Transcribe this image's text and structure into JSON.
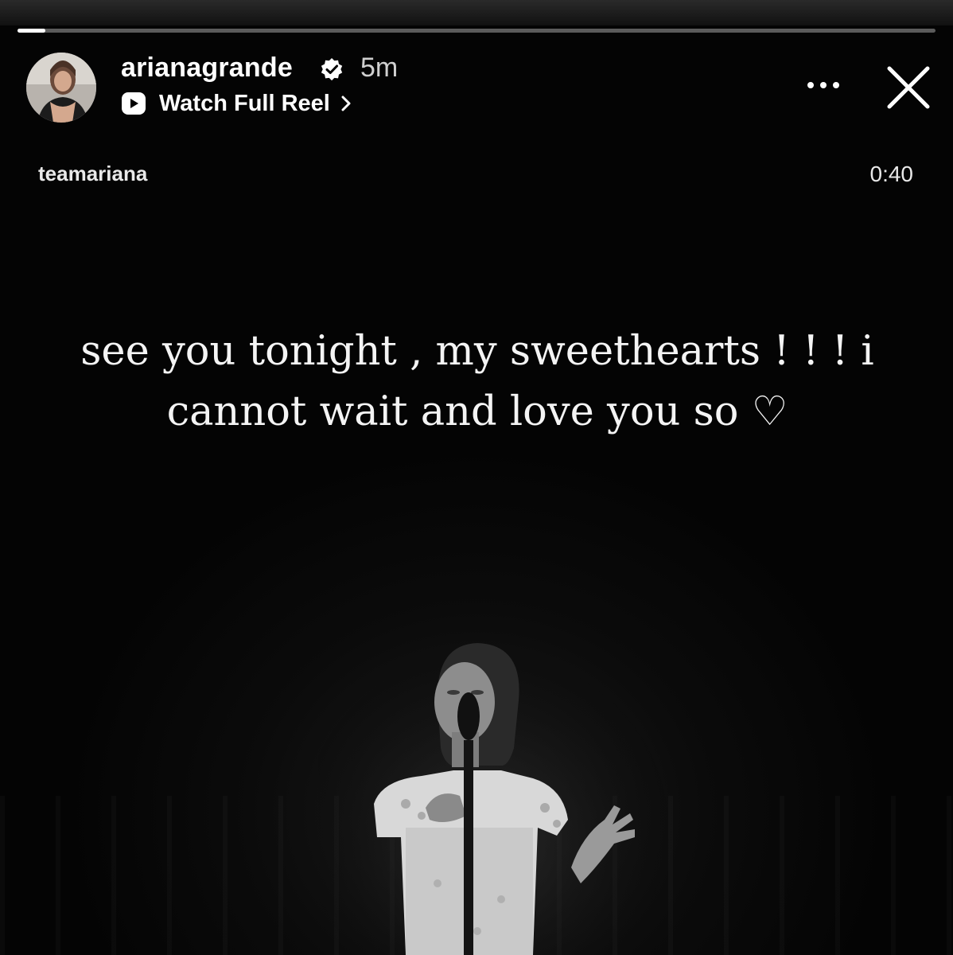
{
  "story": {
    "progress": 0.03,
    "account": {
      "username": "arianagrande",
      "verified": true,
      "posted_ago": "5m",
      "avatar_icon": "profile-photo"
    },
    "link": {
      "label": "Watch Full Reel",
      "icon": "reel-play-icon"
    },
    "actions": {
      "more_icon": "more-icon",
      "close_icon": "close-icon"
    },
    "reel": {
      "source_account": "teamariana",
      "duration": "0:40",
      "caption_line1": "see you tonight , my sweethearts ! ! ! i",
      "caption_line2": "cannot wait and love you so ♡"
    }
  }
}
